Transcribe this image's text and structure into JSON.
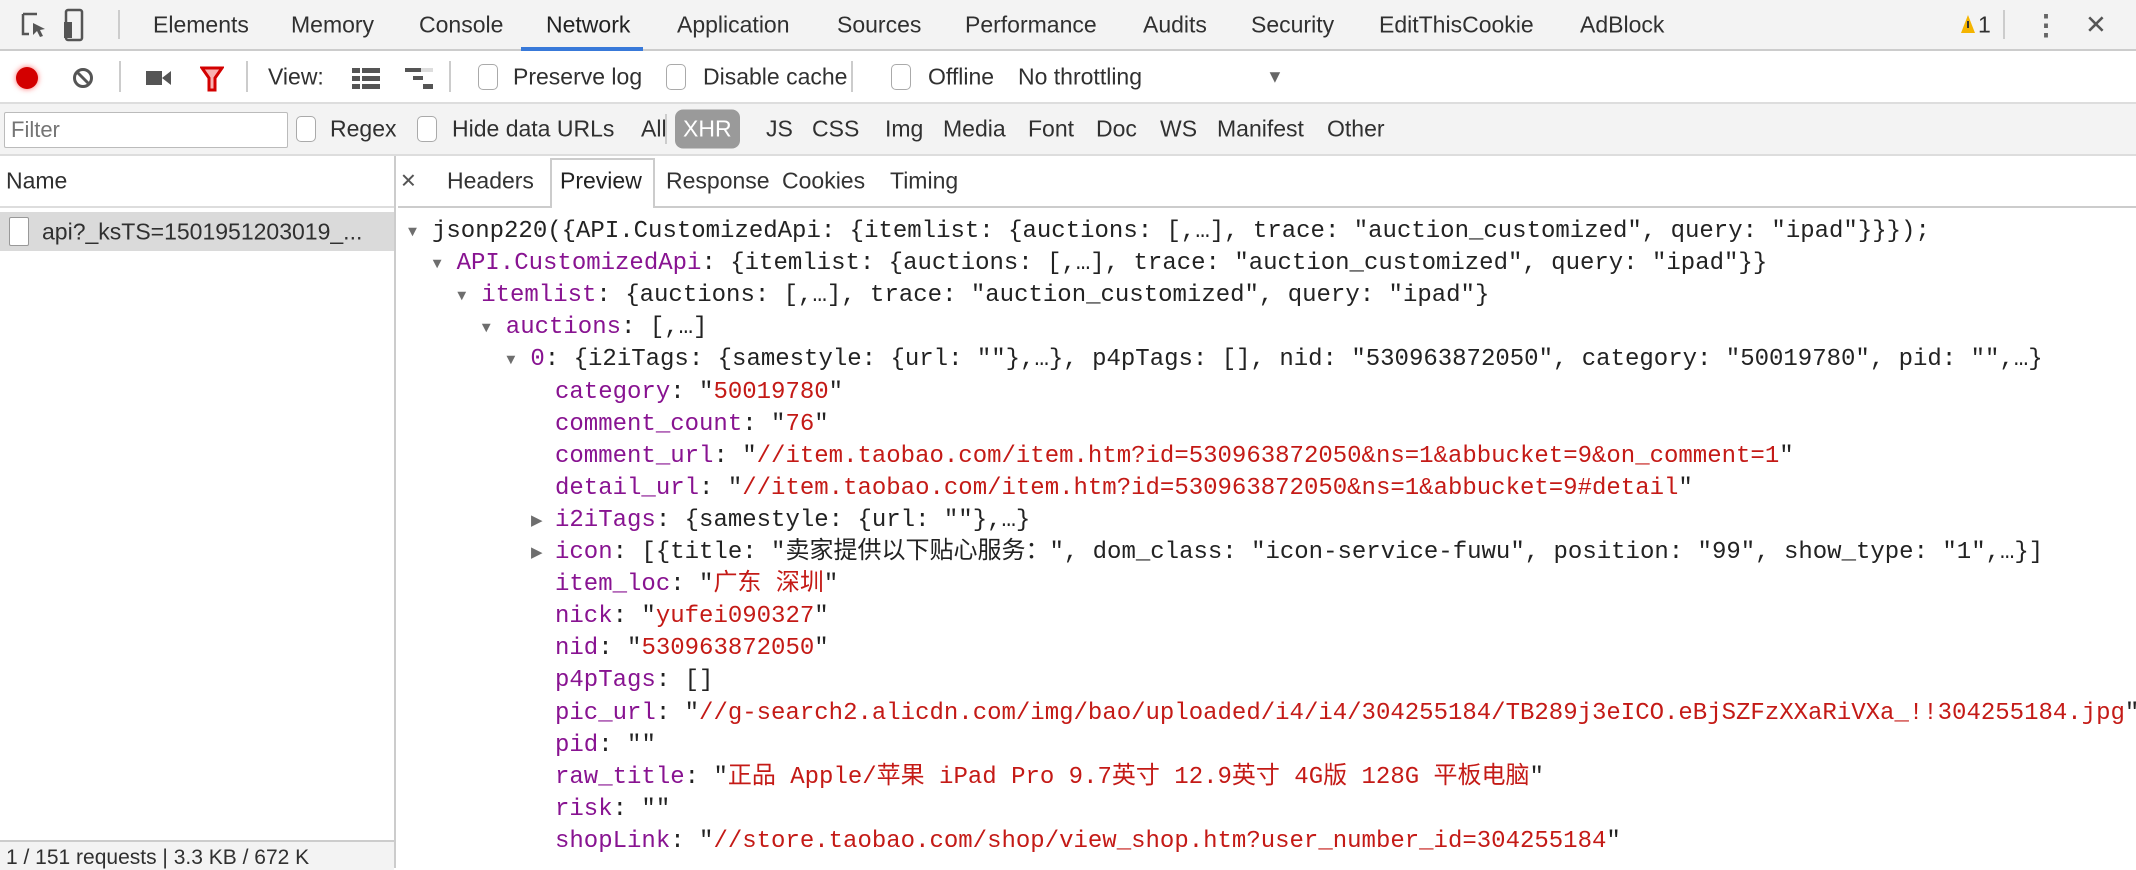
{
  "tabs": [
    "Elements",
    "Memory",
    "Console",
    "Network",
    "Application",
    "Sources",
    "Performance",
    "Audits",
    "Security",
    "EditThisCookie",
    "AdBlock"
  ],
  "active_tab": "Network",
  "warning_count": "1",
  "toolbar": {
    "view_label": "View:",
    "preserve_log": "Preserve log",
    "disable_cache": "Disable cache",
    "offline": "Offline",
    "throttling": "No throttling",
    "dropdown_arrow": "▼"
  },
  "filter": {
    "placeholder": "Filter",
    "regex": "Regex",
    "hide_data_urls": "Hide data URLs",
    "types": [
      "All",
      "XHR",
      "JS",
      "CSS",
      "Img",
      "Media",
      "Font",
      "Doc",
      "WS",
      "Manifest",
      "Other"
    ],
    "active_type": "XHR"
  },
  "requests": {
    "column": "Name",
    "items": [
      "api?_ksTS=1501951203019_..."
    ],
    "status": "1 / 151 requests | 3.3 KB / 672 K"
  },
  "detail_tabs": [
    "Headers",
    "Preview",
    "Response",
    "Cookies",
    "Timing"
  ],
  "active_detail_tab": "Preview",
  "colors": {
    "key": "#881391",
    "string": "#c41a16",
    "accent": "#3879d9",
    "record": "#d30000"
  },
  "preview_lines": [
    {
      "level": 0,
      "arrow": "down",
      "key": "",
      "value": "jsonp220({API.CustomizedApi: {itemlist: {auctions: [,…], trace: \"auction_customized\", query: \"ipad\"}}});",
      "type": "summary"
    },
    {
      "level": 1,
      "arrow": "down",
      "key": "API.CustomizedApi",
      "value": "{itemlist: {auctions: [,…], trace: \"auction_customized\", query: \"ipad\"}}",
      "type": "summary"
    },
    {
      "level": 2,
      "arrow": "down",
      "key": "itemlist",
      "value": "{auctions: [,…], trace: \"auction_customized\", query: \"ipad\"}",
      "type": "summary"
    },
    {
      "level": 3,
      "arrow": "down",
      "key": "auctions",
      "value": "[,…]",
      "type": "summary"
    },
    {
      "level": 4,
      "arrow": "down",
      "key": "0",
      "value": "{i2iTags: {samestyle: {url: \"\"},…}, p4pTags: [], nid: \"530963872050\", category: \"50019780\", pid: \"\",…}",
      "type": "summary"
    },
    {
      "level": 5,
      "arrow": "",
      "key": "category",
      "value": "50019780",
      "type": "string"
    },
    {
      "level": 5,
      "arrow": "",
      "key": "comment_count",
      "value": "76",
      "type": "string"
    },
    {
      "level": 5,
      "arrow": "",
      "key": "comment_url",
      "value": "//item.taobao.com/item.htm?id=530963872050&ns=1&abbucket=9&on_comment=1",
      "type": "string"
    },
    {
      "level": 5,
      "arrow": "",
      "key": "detail_url",
      "value": "//item.taobao.com/item.htm?id=530963872050&ns=1&abbucket=9#detail",
      "type": "string"
    },
    {
      "level": 5,
      "arrow": "right",
      "key": "i2iTags",
      "value": "{samestyle: {url: \"\"},…}",
      "type": "summary"
    },
    {
      "level": 5,
      "arrow": "right",
      "key": "icon",
      "value": "[{title: \"卖家提供以下贴心服务：\", dom_class: \"icon-service-fuwu\", position: \"99\", show_type: \"1\",…}]",
      "type": "summary"
    },
    {
      "level": 5,
      "arrow": "",
      "key": "item_loc",
      "value": "广东 深圳",
      "type": "string"
    },
    {
      "level": 5,
      "arrow": "",
      "key": "nick",
      "value": "yufei090327",
      "type": "string"
    },
    {
      "level": 5,
      "arrow": "",
      "key": "nid",
      "value": "530963872050",
      "type": "string"
    },
    {
      "level": 5,
      "arrow": "",
      "key": "p4pTags",
      "value": "[]",
      "type": "summary"
    },
    {
      "level": 5,
      "arrow": "",
      "key": "pic_url",
      "value": "//g-search2.alicdn.com/img/bao/uploaded/i4/i4/304255184/TB289j3eICO.eBjSZFzXXaRiVXa_!!304255184.jpg",
      "type": "string"
    },
    {
      "level": 5,
      "arrow": "",
      "key": "pid",
      "value": "",
      "type": "string"
    },
    {
      "level": 5,
      "arrow": "",
      "key": "raw_title",
      "value": "正品 Apple/苹果 iPad Pro 9.7英寸 12.9英寸 4G版 128G 平板电脑",
      "type": "string"
    },
    {
      "level": 5,
      "arrow": "",
      "key": "risk",
      "value": "",
      "type": "string"
    },
    {
      "level": 5,
      "arrow": "",
      "key": "shopLink",
      "value": "//store.taobao.com/shop/view_shop.htm?user_number_id=304255184",
      "type": "string"
    }
  ]
}
